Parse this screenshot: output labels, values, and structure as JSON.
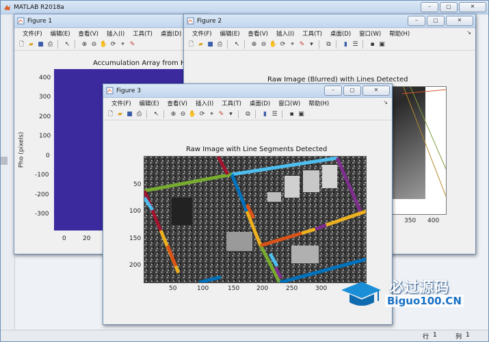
{
  "main_window": {
    "title": "MATLAB R2018a"
  },
  "menu": [
    "文件(F)",
    "编辑(E)",
    "查看(V)",
    "插入(I)",
    "工具(T)",
    "桌面(D)",
    "窗口(W)",
    "帮助(H)"
  ],
  "figure1": {
    "title": "Figure 1",
    "axes_title": "Accumulation Array from Ho",
    "ylabel": "Pho (pixels)",
    "yticks": [
      "400",
      "300",
      "200",
      "100",
      "0",
      "-100",
      "-200",
      "-300"
    ],
    "xticks": [
      "0",
      "20"
    ]
  },
  "figure2": {
    "title": "Figure 2",
    "axes_title": "Raw Image (Blurred) with Lines Detected",
    "xticks": [
      "350",
      "400"
    ]
  },
  "figure3": {
    "title": "Figure 3",
    "axes_title": "Raw Image with Line Segments Detected",
    "yticks": [
      "50",
      "100",
      "150",
      "200"
    ],
    "xticks": [
      "50",
      "100",
      "150",
      "200",
      "250",
      "300"
    ]
  },
  "watermark": {
    "brand_cn": "必过源码",
    "brand_en": "Biguo100.CN"
  },
  "statusbar": {
    "row_label": "行",
    "row_value": "1",
    "col_label": "列",
    "col_value": "1"
  },
  "colors": {
    "accumulator_fill": "#3a2a9e",
    "desktop": "#5c86b8"
  }
}
